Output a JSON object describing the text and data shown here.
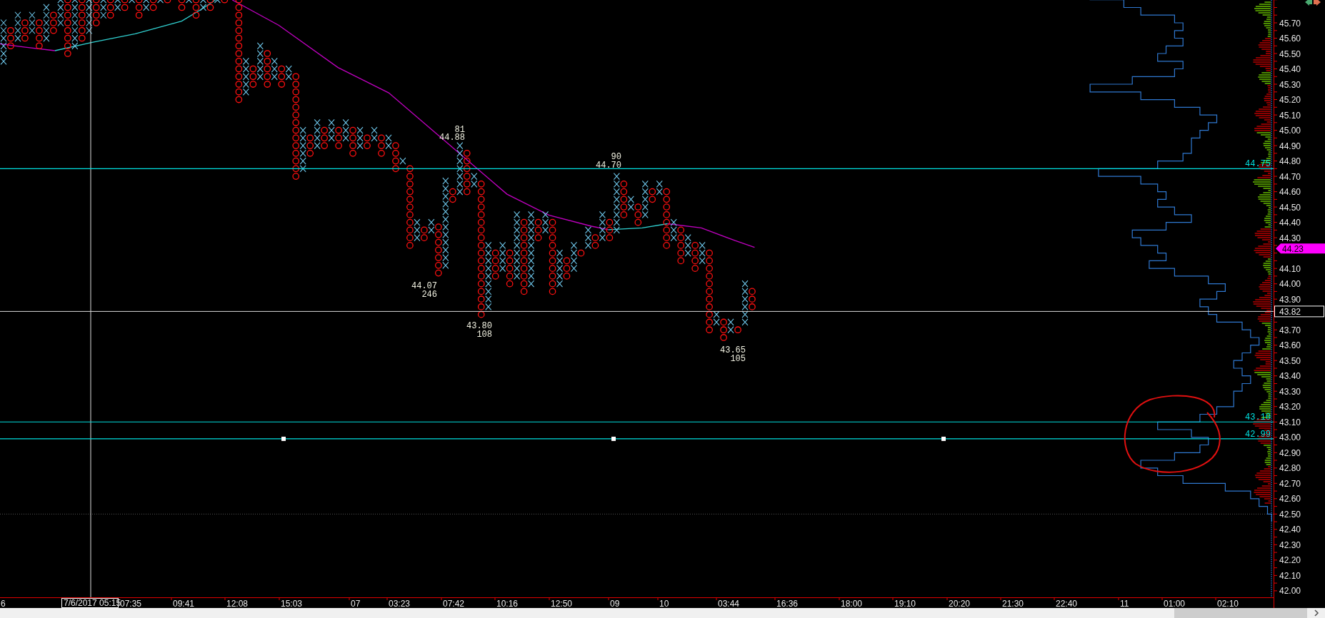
{
  "chart": {
    "annotations": [
      {
        "kind": "high",
        "count": "81",
        "price": "44.88"
      },
      {
        "kind": "high",
        "count": "90",
        "price": "44.70"
      },
      {
        "kind": "low",
        "price": "44.07",
        "count": "246"
      },
      {
        "kind": "low",
        "price": "43.80",
        "count": "108"
      },
      {
        "kind": "low",
        "price": "43.65",
        "count": "105"
      }
    ],
    "horizontal_lines": [
      {
        "kind": "level",
        "label": "44.75",
        "color": "#00e0e0"
      },
      {
        "kind": "level",
        "label": "43.10",
        "color": "#00e0e0"
      },
      {
        "kind": "handles",
        "label": "42.99",
        "color": "#00e0e0"
      }
    ],
    "crosshair": {
      "price": "43.82",
      "time": "7/6/2017 05:15"
    },
    "last_price": {
      "value": "44.23",
      "color": "#ff00ff"
    }
  },
  "price_axis": {
    "labels": [
      "45.70",
      "45.60",
      "45.50",
      "45.40",
      "45.30",
      "45.20",
      "45.10",
      "45.00",
      "44.90",
      "44.80",
      "44.70",
      "44.60",
      "44.50",
      "44.40",
      "44.30",
      "44.10",
      "44.00",
      "43.90",
      "43.70",
      "43.60",
      "43.50",
      "43.40",
      "43.30",
      "43.20",
      "43.10",
      "43.00",
      "42.90",
      "42.80",
      "42.70",
      "42.60",
      "42.50",
      "42.40",
      "42.30",
      "42.20",
      "42.10",
      "42.00"
    ]
  },
  "time_axis": {
    "labels": [
      "6",
      "07:35",
      "09:41",
      "12:08",
      "15:03",
      "07",
      "03:23",
      "07:42",
      "10:16",
      "12:50",
      "09",
      "10",
      "03:44",
      "16:36",
      "18:00",
      "19:10",
      "20:20",
      "21:30",
      "22:40",
      "11",
      "01:00",
      "02:10"
    ]
  }
}
